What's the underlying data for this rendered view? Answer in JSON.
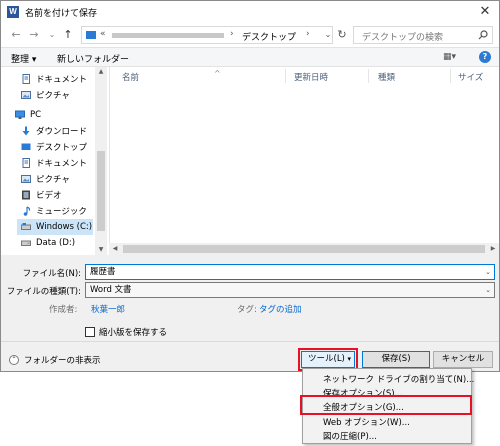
{
  "window": {
    "title": "名前を付けて保存",
    "icon": "word-icon",
    "close": "✕"
  },
  "nav": {
    "back": "←",
    "forward": "→",
    "history": "⌄",
    "up": "↑",
    "address_prefix": "«",
    "current_folder": "デスクトップ",
    "separator": "›",
    "dropdown": "⌄",
    "refresh": "↻",
    "search_placeholder": "デスクトップの検索"
  },
  "toolbar": {
    "organize": "整理 ▾",
    "new_folder": "新しいフォルダー",
    "view": "▦▾",
    "help": "?"
  },
  "navpane": {
    "items": [
      {
        "label": "ドキュメント",
        "icon": "document-icon"
      },
      {
        "label": "ピクチャ",
        "icon": "picture-icon"
      },
      {
        "label": "PC",
        "icon": "pc-icon"
      },
      {
        "label": "ダウンロード",
        "icon": "download-icon"
      },
      {
        "label": "デスクトップ",
        "icon": "desktop-icon"
      },
      {
        "label": "ドキュメント",
        "icon": "document-icon"
      },
      {
        "label": "ピクチャ",
        "icon": "picture-icon"
      },
      {
        "label": "ビデオ",
        "icon": "video-icon"
      },
      {
        "label": "ミュージック",
        "icon": "music-icon"
      },
      {
        "label": "Windows (C:)",
        "icon": "drive-icon"
      },
      {
        "label": "Data (D:)",
        "icon": "drive-icon"
      }
    ]
  },
  "filelist": {
    "columns": [
      "名前",
      "更新日時",
      "種類",
      "サイズ"
    ],
    "sort_arrow": "^"
  },
  "form": {
    "filename_label": "ファイル名(N):",
    "filename_value": "履歴書",
    "filetype_label": "ファイルの種類(T):",
    "filetype_value": "Word 文書",
    "author_label": "作成者:",
    "author_value": "秋葉一郎",
    "tags_label": "タグ:",
    "tags_value": "タグの追加",
    "thumbnail_label": "縮小版を保存する",
    "dropdown_arrow": "⌄"
  },
  "bottom": {
    "hide_folders": "フォルダーの非表示",
    "hide_icon": "⌃",
    "tools": "ツール(L)",
    "tools_arrow": "▾",
    "save": "保存(S)",
    "cancel": "キャンセル"
  },
  "tools_menu": {
    "items": [
      "ネットワーク ドライブの割り当て(N)...",
      "保存オプション(S)...",
      "全般オプション(G)...",
      "Web オプション(W)...",
      "図の圧縮(P)..."
    ]
  },
  "colors": {
    "accent": "#0078d7",
    "highlight_red": "#e81123",
    "folder_blue": "#2b7ad4"
  }
}
